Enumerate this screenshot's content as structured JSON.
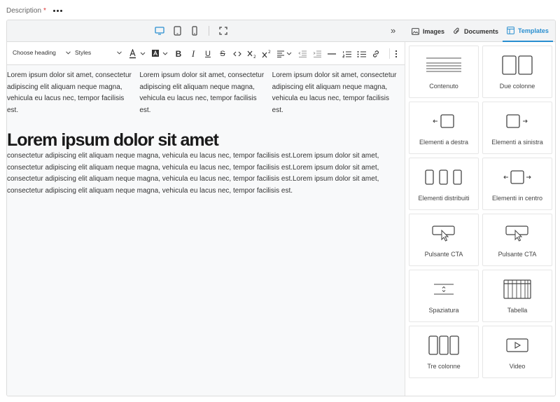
{
  "field": {
    "label": "Description",
    "required_mark": "*"
  },
  "topbar": {
    "collapse_glyph": "»",
    "tabs": [
      {
        "label": "Images",
        "icon": "image-icon",
        "active": false
      },
      {
        "label": "Documents",
        "icon": "paperclip-icon",
        "active": false
      },
      {
        "label": "Templates",
        "icon": "template-icon",
        "active": true
      }
    ]
  },
  "toolbar": {
    "heading_select": "Choose heading",
    "styles_select": "Styles"
  },
  "editor": {
    "columns": [
      "Lorem ipsum dolor sit amet, consectetur adipiscing elit aliquam neque magna, vehicula eu lacus nec, tempor facilisis est.",
      "Lorem ipsum dolor sit amet, consectetur adipiscing elit aliquam neque magna, vehicula eu lacus nec, tempor facilisis est.",
      "Lorem ipsum dolor sit amet, consectetur adipiscing elit aliquam neque magna, vehicula eu lacus nec, tempor facilisis est."
    ],
    "heading": "Lorem ipsum dolor sit amet",
    "paragraph": "consectetur adipiscing elit aliquam neque magna, vehicula eu lacus nec, tempor facilisis est.Lorem ipsum dolor sit amet, consectetur adipiscing elit aliquam neque magna, vehicula eu lacus nec, tempor facilisis est.Lorem ipsum dolor sit amet, consectetur adipiscing elit aliquam neque magna, vehicula eu lacus nec, tempor facilisis est.Lorem ipsum dolor sit amet, consectetur adipiscing elit aliquam neque magna, vehicula eu lacus nec, tempor facilisis est."
  },
  "templates": [
    {
      "label": "Contenuto",
      "icon": "content-lines-icon"
    },
    {
      "label": "Due colonne",
      "icon": "two-columns-icon"
    },
    {
      "label": "Elementi a destra",
      "icon": "elements-right-icon"
    },
    {
      "label": "Elementi a sinistra",
      "icon": "elements-left-icon"
    },
    {
      "label": "Elementi distribuiti",
      "icon": "elements-distributed-icon"
    },
    {
      "label": "Elementi in centro",
      "icon": "elements-center-icon"
    },
    {
      "label": "Pulsante CTA",
      "icon": "cta-button-icon"
    },
    {
      "label": "Pulsante CTA",
      "icon": "cta-button-icon"
    },
    {
      "label": "Spaziatura",
      "icon": "spacer-icon"
    },
    {
      "label": "Tabella",
      "icon": "table-icon"
    },
    {
      "label": "Tre colonne",
      "icon": "three-columns-icon"
    },
    {
      "label": "Video",
      "icon": "video-icon"
    }
  ],
  "colors": {
    "accent": "#2a8fd0",
    "required": "#dd3333"
  }
}
